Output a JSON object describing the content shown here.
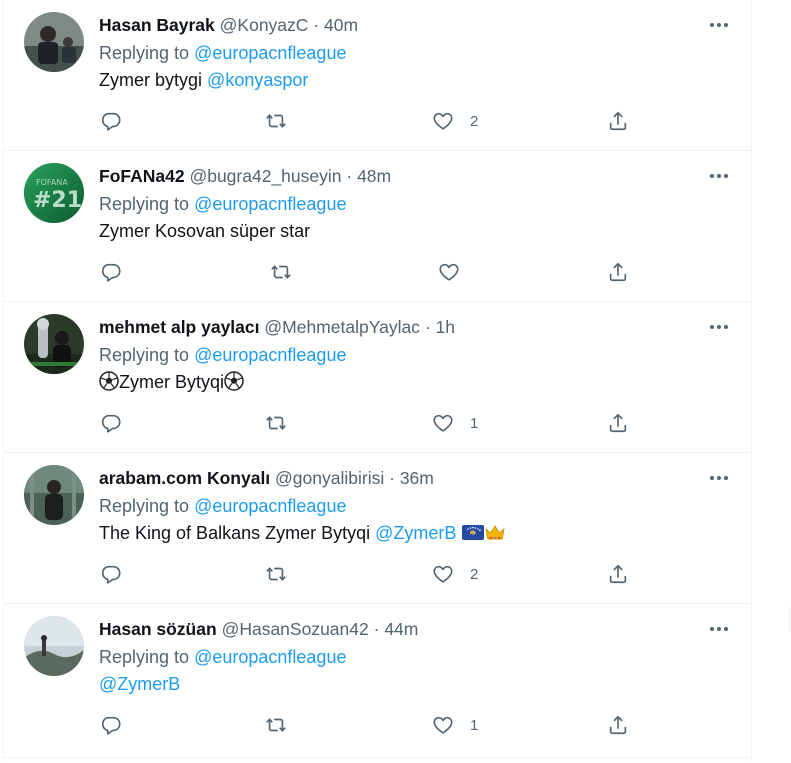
{
  "tweets": [
    {
      "name": "Hasan Bayrak",
      "handle": "@KonyazC",
      "separator": "·",
      "time": "40m",
      "replying_prefix": "Replying to",
      "replying_to": "@europacnfleague",
      "text_plain": "Zymer bytygi",
      "text_mention": "@konyaspor",
      "likes": "2",
      "avatar_color": "#5f6b5a"
    },
    {
      "name": "FoFANa42",
      "handle": "@bugra42_huseyin",
      "separator": "·",
      "time": "48m",
      "replying_prefix": "Replying to",
      "replying_to": "@europacnfleague",
      "text_plain": "Zymer Kosovan süper star",
      "likes": "",
      "avatar_color": "#1f8a4c"
    },
    {
      "name": "mehmet alp yaylacı",
      "handle": "@MehmetalpYaylac",
      "separator": "·",
      "time": "1h",
      "replying_prefix": "Replying to",
      "replying_to": "@europacnfleague",
      "text_plain": "Zymer Bytyqi",
      "likes": "1",
      "avatar_color": "#2b4a2a"
    },
    {
      "name": "arabam.com Konyalı",
      "handle": "@gonyalibirisi",
      "separator": "·",
      "time": "36m",
      "replying_prefix": "Replying to",
      "replying_to": "@europacnfleague",
      "text_plain": "The King of Balkans Zymer Bytyqi",
      "text_mention": "@ZymerB",
      "likes": "2",
      "avatar_color": "#3d5a4a"
    },
    {
      "name": "Hasan sözüan",
      "handle": "@HasanSozuan42",
      "separator": "·",
      "time": "44m",
      "replying_prefix": "Replying to",
      "replying_to": "@europacnfleague",
      "text_mention": "@ZymerB",
      "likes": "1",
      "avatar_color": "#9aa7ad"
    }
  ],
  "icons": {
    "reply": "reply-icon",
    "retweet": "retweet-icon",
    "like": "heart-icon",
    "share": "share-icon",
    "more": "more-icon"
  },
  "colors": {
    "link": "#1d9bf0",
    "secondary": "#536471",
    "border": "#eff3f4"
  }
}
